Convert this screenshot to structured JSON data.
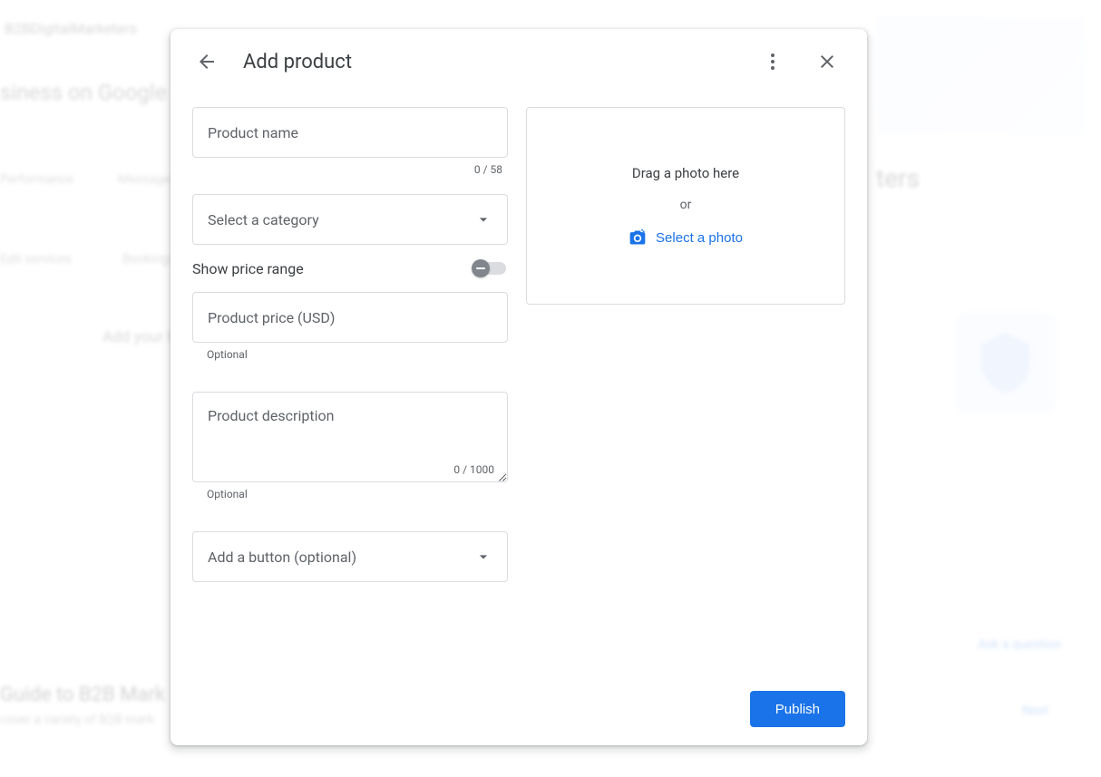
{
  "background": {
    "brand": "B2BDigitalMarketers",
    "title": "siness on Google",
    "link1": "Performance",
    "link2": "Messages",
    "link3": "Edit services",
    "link4": "Bookings",
    "tip": "Add your hours",
    "side_big": "ters",
    "guide": "Guide to B2B Mark",
    "b2b": "cover a variety of B2B mark",
    "ask": "Ask a question",
    "next": "Next"
  },
  "dialog": {
    "title": "Add product",
    "productName": {
      "label": "Product name",
      "counter": "0 / 58"
    },
    "category": {
      "label": "Select a category"
    },
    "priceToggle": {
      "label": "Show price range"
    },
    "price": {
      "label": "Product price (USD)",
      "helper": "Optional"
    },
    "description": {
      "label": "Product description",
      "counter": "0 / 1000",
      "helper": "Optional"
    },
    "buttonSelect": {
      "label": "Add a button (optional)"
    },
    "dropzone": {
      "drag": "Drag a photo here",
      "or": "or",
      "select": "Select a photo"
    },
    "publish": "Publish"
  }
}
